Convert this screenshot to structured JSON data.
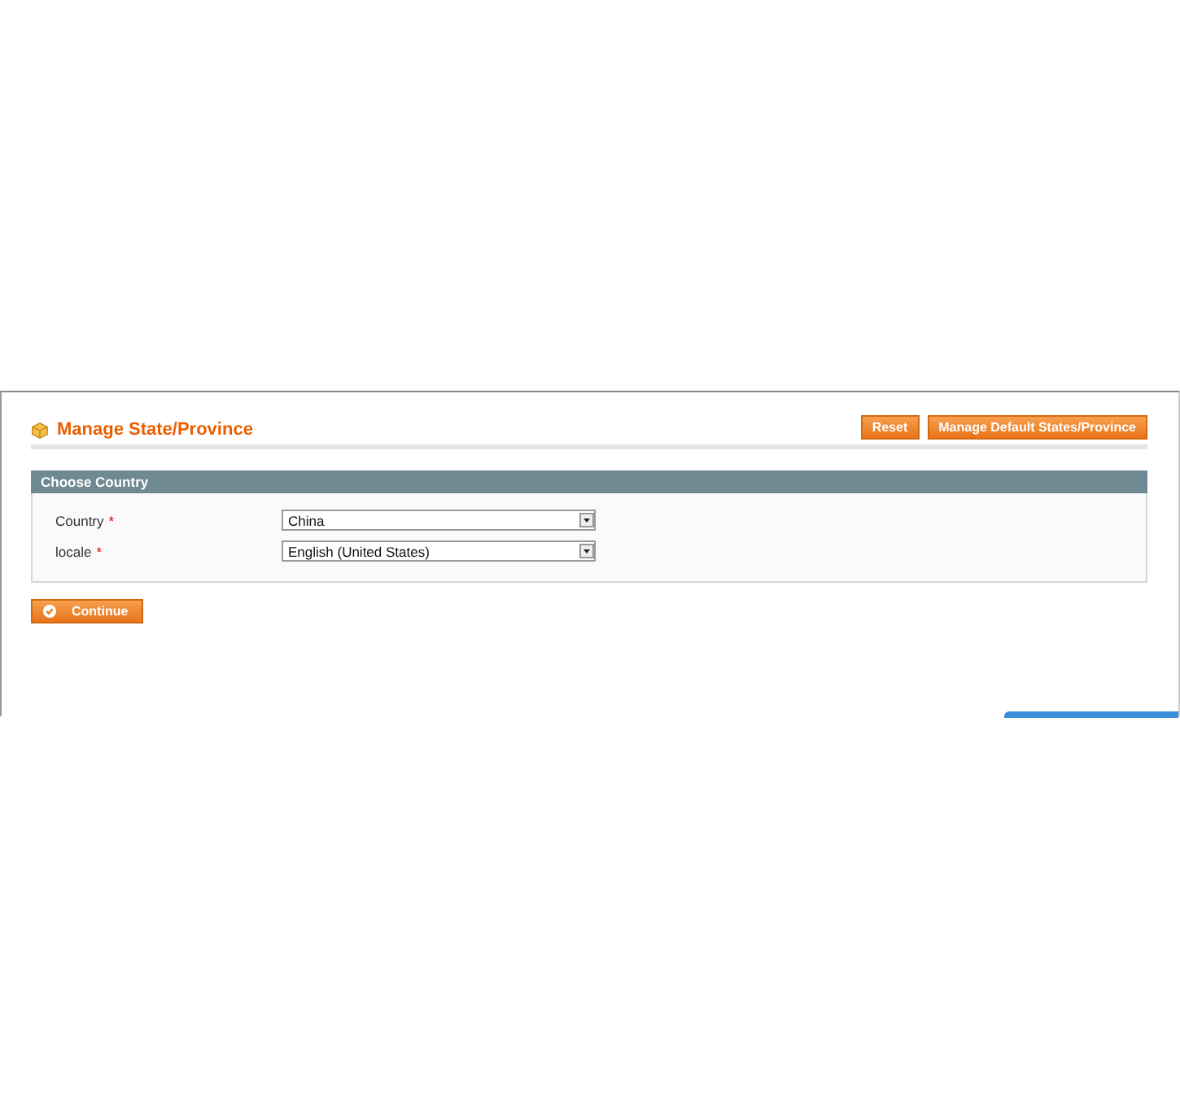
{
  "page": {
    "title": "Manage State/Province"
  },
  "buttons": [
    {
      "label": "Reset"
    },
    {
      "label": "Manage Default States/Province"
    }
  ],
  "section": {
    "title": "Choose Country",
    "fields": [
      {
        "label": "Country",
        "required_mark": "*",
        "value": "China"
      },
      {
        "label": "locale",
        "required_mark": "*",
        "value": "English (United States)"
      }
    ]
  },
  "continue_button": {
    "label": "Continue"
  }
}
